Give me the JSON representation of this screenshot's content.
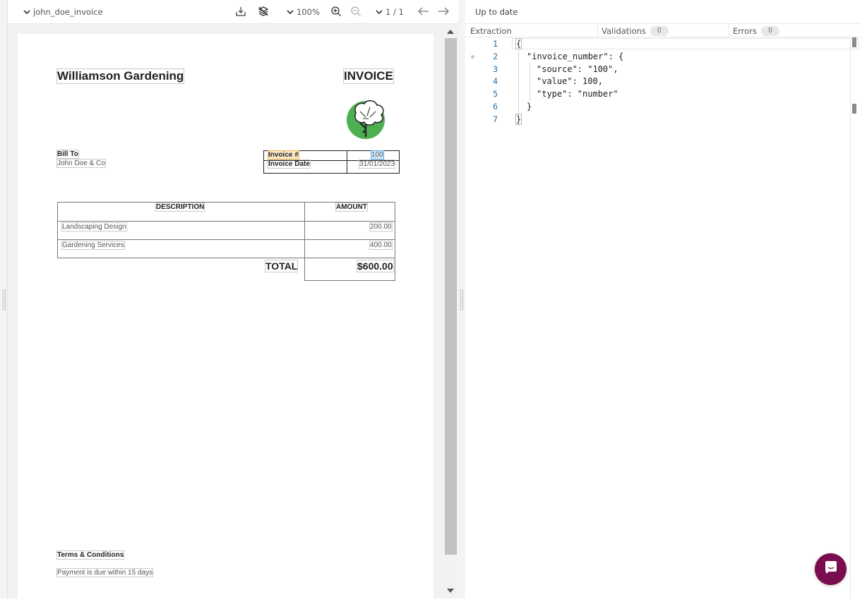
{
  "viewer": {
    "filename": "john_doe_invoice",
    "zoom": "100%",
    "page_indicator": "1 / 1",
    "icons": {
      "file_menu": "chevron-down-icon",
      "download": "download-icon",
      "layers": "layers-hidden-icon",
      "zoom_in": "zoom-in-icon",
      "zoom_out": "zoom-out-icon",
      "prev": "arrow-left-icon",
      "next": "arrow-right-icon"
    }
  },
  "invoice": {
    "company": "Williamson Gardening",
    "title": "INVOICE",
    "bill_to_label": "Bill To",
    "bill_to_value": "John Doe & Co",
    "invoice_no_label": "Invoice #",
    "invoice_no_value": "100",
    "invoice_date_label": "Invoice Date",
    "invoice_date_value": "31/01/2023",
    "col_description": "DESCRIPTION",
    "col_amount": "AMOUNT",
    "items": [
      {
        "description": "Landscaping Design",
        "amount": "200.00"
      },
      {
        "description": "Gardening Services",
        "amount": "400.00"
      }
    ],
    "total_label": "TOTAL",
    "total_value": "$600.00",
    "terms_label": "Terms & Conditions",
    "terms_value": "Payment is due within 15 days"
  },
  "right_panel": {
    "status": "Up to date",
    "tabs": [
      {
        "label": "Extraction"
      },
      {
        "label": "Validations",
        "count": "0"
      },
      {
        "label": "Errors",
        "count": "0"
      }
    ],
    "code_lines": [
      {
        "n": "1",
        "text": "{"
      },
      {
        "n": "2",
        "text": "\"invoice_number\": {"
      },
      {
        "n": "3",
        "text": "\"source\": \"100\","
      },
      {
        "n": "4",
        "text": "\"value\": 100,"
      },
      {
        "n": "5",
        "text": "\"type\": \"number\""
      },
      {
        "n": "6",
        "text": "}"
      },
      {
        "n": "7",
        "text": "}"
      }
    ]
  },
  "colors": {
    "chat_button": "#7a0d4f",
    "line_numbers": "#1e6fa8",
    "highlight_label": "#fde9c8",
    "highlight_value": "#d7ebfb",
    "logo_green": "#4caf50"
  }
}
